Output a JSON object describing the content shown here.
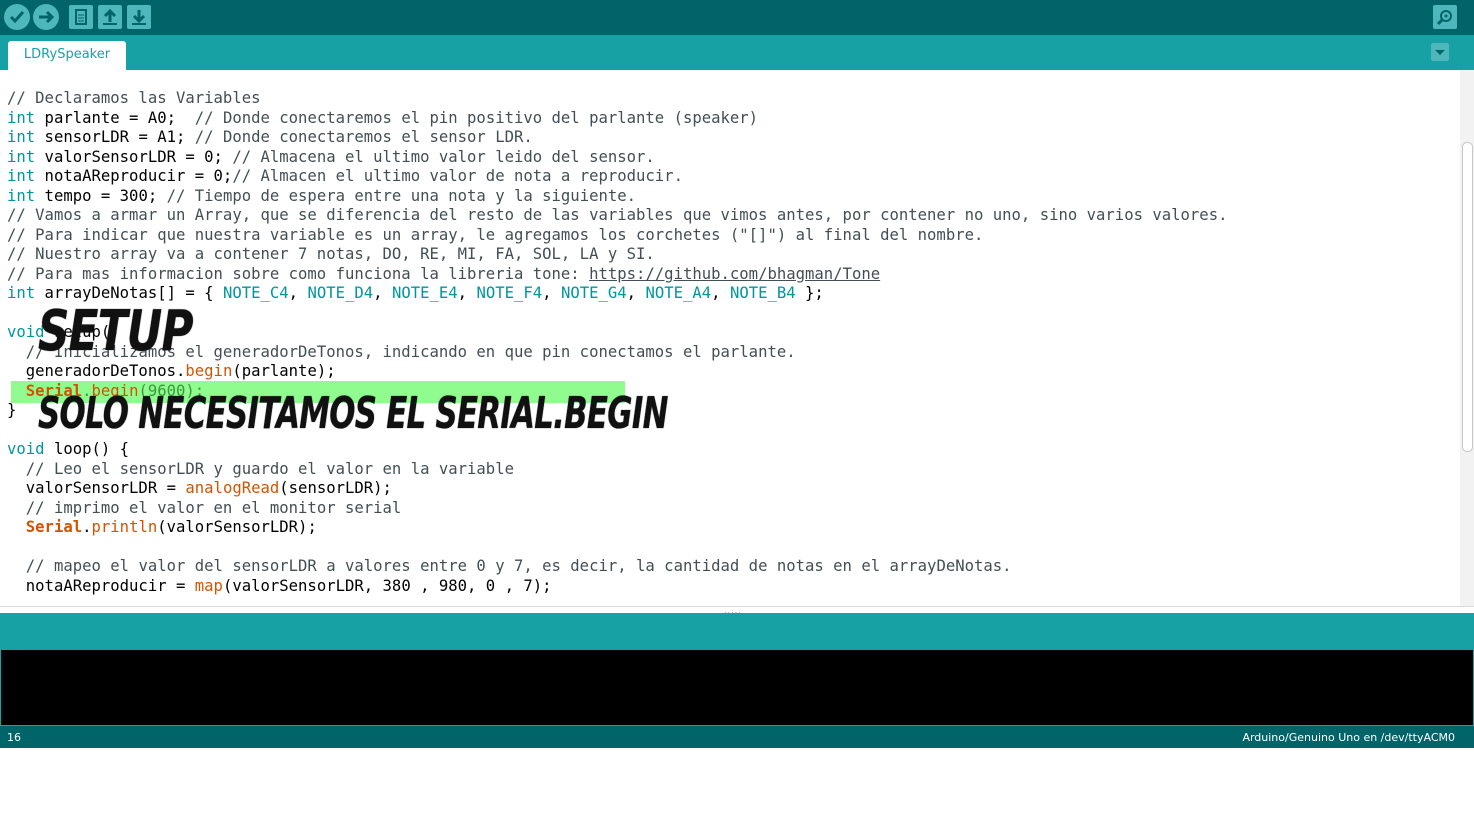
{
  "toolbar": {
    "buttons": [
      {
        "name": "verify",
        "icon": "check-icon"
      },
      {
        "name": "upload",
        "icon": "arrow-right-icon"
      },
      {
        "name": "new",
        "icon": "new-file-icon"
      },
      {
        "name": "open",
        "icon": "open-arrow-up-icon"
      },
      {
        "name": "save",
        "icon": "save-arrow-down-icon"
      }
    ],
    "serial_monitor_icon": "magnifier-icon"
  },
  "tabs": [
    {
      "label": "LDRySpeaker"
    }
  ],
  "tab_menu_icon": "triangle-down-icon",
  "editor": {
    "lines": [
      "// Declaramos las Variables",
      "int parlante = A0;  // Donde conectaremos el pin positivo del parlante (speaker)",
      "int sensorLDR = A1; // Donde conectaremos el sensor LDR.",
      "int valorSensorLDR = 0; // Almacena el ultimo valor leido del sensor.",
      "int notaAReproducir = 0;// Almacen el ultimo valor de nota a reproducir.",
      "int tempo = 300; // Tiempo de espera entre una nota y la siguiente.",
      "// Vamos a armar un Array, que se diferencia del resto de las variables que vimos antes, por contener no uno, sino varios valores.",
      "// Para indicar que nuestra variable es un array, le agregamos los corchetes (\"[]\") al final del nombre.",
      "// Nuestro array va a contener 7 notas, DO, RE, MI, FA, SOL, LA y SI.",
      "// Para mas informacion sobre como funciona la libreria tone: https://github.com/bhagman/Tone",
      "int arrayDeNotas[] = { NOTE_C4, NOTE_D4, NOTE_E4, NOTE_F4, NOTE_G4, NOTE_A4, NOTE_B4 };",
      "",
      "void setup() {",
      "  // Inicializamos el generadorDeTonos, indicando en que pin conectamos el parlante.",
      "  generadorDeTonos.begin(parlante);",
      "  Serial.begin(9600);",
      "}",
      "",
      "void loop() {",
      "  // Leo el sensorLDR y guardo el valor en la variable",
      "  valorSensorLDR = analogRead(sensorLDR);",
      "  // imprimo el valor en el monitor serial",
      "  Serial.println(valorSensorLDR);",
      "",
      "  // mapeo el valor del sensorLDR a valores entre 0 y 7, es decir, la cantidad de notas en el arrayDeNotas.",
      "  notaAReproducir = map(valorSensorLDR, 380 , 980, 0 , 7);"
    ],
    "link_text": "https://github.com/bhagman/Tone"
  },
  "annotations": {
    "title": "SETUP",
    "note": "SOLO NECESITAMOS EL SERIAL.BEGIN"
  },
  "status_message": "",
  "console_text": "",
  "footer": {
    "line_number": "16",
    "board": "Arduino/Genuino Uno en /dev/ttyACM0"
  },
  "colors": {
    "toolbar_bg": "#006468",
    "tabbar_bg": "#17a1a5",
    "keyword": "#00979c",
    "function": "#d35400",
    "highlight": "#7cfc7c"
  }
}
